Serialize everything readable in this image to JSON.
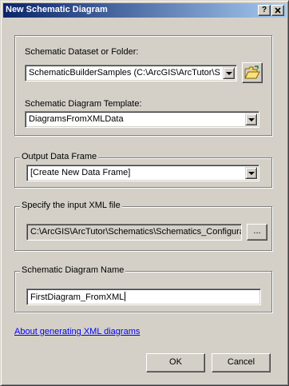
{
  "window": {
    "title": "New Schematic Diagram",
    "help_button": "?",
    "close_button": "X"
  },
  "dataset": {
    "label": "Schematic Dataset or Folder:",
    "value": "SchematicBuilderSamples (C:\\ArcGIS\\ArcTutor\\Sch",
    "browse_icon": "open-folder-icon"
  },
  "template": {
    "label": "Schematic Diagram Template:",
    "value": "DiagramsFromXMLData"
  },
  "output_frame": {
    "legend": "Output Data Frame",
    "value": "[Create New Data Frame]"
  },
  "xml_file": {
    "legend": "Specify the input XML file",
    "value": "C:\\ArcGIS\\ArcTutor\\Schematics\\Schematics_Configura",
    "browse_label": "..."
  },
  "diagram_name": {
    "legend": "Schematic Diagram Name",
    "value": "FirstDiagram_FromXML"
  },
  "help_link": "About generating XML diagrams",
  "buttons": {
    "ok": "OK",
    "cancel": "Cancel"
  },
  "colors": {
    "dialog_face": "#d4d0c8",
    "title_start": "#0a246a",
    "title_end": "#a6caf0",
    "link": "#0000ff"
  }
}
